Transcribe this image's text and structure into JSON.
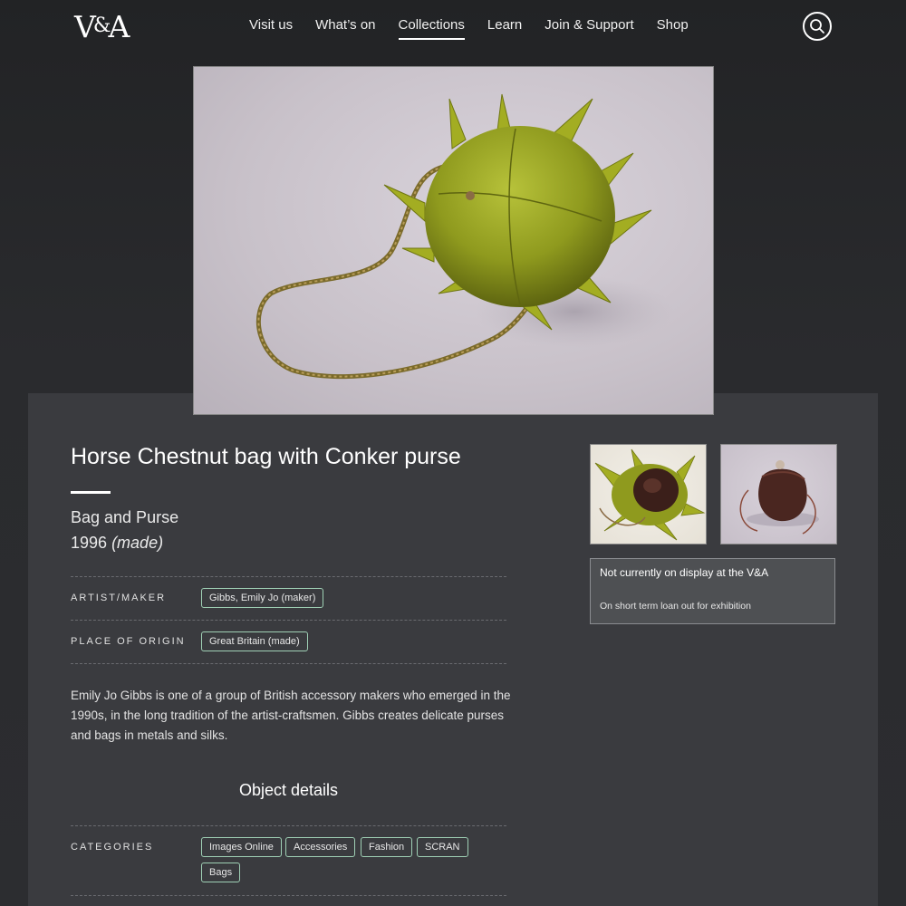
{
  "brand": {
    "logo_left": "V",
    "logo_amp": "&",
    "logo_right": "A"
  },
  "nav": [
    {
      "label": "Visit us"
    },
    {
      "label": "What’s on"
    },
    {
      "label": "Collections"
    },
    {
      "label": "Learn"
    },
    {
      "label": "Join & Support"
    },
    {
      "label": "Shop"
    }
  ],
  "nav_active": "Collections",
  "search_icon": "search-icon",
  "object": {
    "title": "Horse Chestnut bag with Conker purse",
    "type": "Bag and Purse",
    "year": "1996",
    "year_note": "(made)",
    "artist_label": "ARTIST/MAKER",
    "artist_value": "Gibbs, Emily Jo (maker)",
    "origin_label": "PLACE OF ORIGIN",
    "origin_value": "Great Britain (made)",
    "description": "Emily Jo Gibbs is one of a group of British accessory makers who emerged in the 1990s, in the long tradition of the artist-craftsmen. Gibbs creates delicate purses and bags in metals and silks."
  },
  "details": {
    "heading": "Object details",
    "categories_label": "CATEGORIES",
    "categories": [
      "Images Online",
      "Accessories",
      "Fashion",
      "SCRAN",
      "Bags"
    ]
  },
  "display_status": {
    "title": "Not currently on display at the V&A",
    "subtitle": "On short term loan out for exhibition"
  },
  "colors": {
    "page_bg": "#2a2b2e",
    "card_bg": "#3a3b3f",
    "tag_border": "#9fd0b5",
    "status_box": "#4e5053"
  }
}
